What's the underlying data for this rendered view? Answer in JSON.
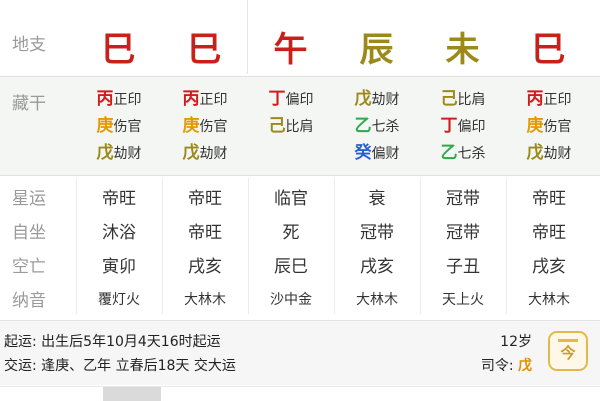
{
  "tiangan_top": [
    {
      "char": "",
      "color": "#2ea84a"
    },
    {
      "char": "",
      "color": "#2ea84a"
    },
    {
      "char": "",
      "color": "#2ea84a"
    },
    {
      "char": "",
      "color": "#2ea84a"
    },
    {
      "char": "",
      "color": "#2ea84a"
    },
    {
      "char": "",
      "color": "#2ea84a"
    }
  ],
  "dizhi": {
    "label": "地支",
    "columns": [
      {
        "char": "巳",
        "color": "#c8201a"
      },
      {
        "char": "巳",
        "color": "#c8201a"
      },
      {
        "char": "午",
        "color": "#c8201a"
      },
      {
        "char": "辰",
        "color": "#9b8a1a"
      },
      {
        "char": "未",
        "color": "#9b8a1a"
      },
      {
        "char": "巳",
        "color": "#c8201a"
      }
    ]
  },
  "canggan": {
    "label": "藏干",
    "columns": [
      [
        {
          "gan": "丙",
          "shishen": "正印",
          "color": "#d21c1c"
        },
        {
          "gan": "庚",
          "shishen": "伤官",
          "color": "#e39a00"
        },
        {
          "gan": "戊",
          "shishen": "劫财",
          "color": "#9b8a1a"
        }
      ],
      [
        {
          "gan": "丙",
          "shishen": "正印",
          "color": "#d21c1c"
        },
        {
          "gan": "庚",
          "shishen": "伤官",
          "color": "#e39a00"
        },
        {
          "gan": "戊",
          "shishen": "劫财",
          "color": "#9b8a1a"
        }
      ],
      [
        {
          "gan": "丁",
          "shishen": "偏印",
          "color": "#d21c1c"
        },
        {
          "gan": "己",
          "shishen": "比肩",
          "color": "#9b8a1a"
        }
      ],
      [
        {
          "gan": "戊",
          "shishen": "劫财",
          "color": "#9b8a1a"
        },
        {
          "gan": "乙",
          "shishen": "七杀",
          "color": "#2ea84a"
        },
        {
          "gan": "癸",
          "shishen": "偏财",
          "color": "#2a5fd4"
        }
      ],
      [
        {
          "gan": "己",
          "shishen": "比肩",
          "color": "#9b8a1a"
        },
        {
          "gan": "丁",
          "shishen": "偏印",
          "color": "#d21c1c"
        },
        {
          "gan": "乙",
          "shishen": "七杀",
          "color": "#2ea84a"
        }
      ],
      [
        {
          "gan": "丙",
          "shishen": "正印",
          "color": "#d21c1c"
        },
        {
          "gan": "庚",
          "shishen": "伤官",
          "color": "#e39a00"
        },
        {
          "gan": "戊",
          "shishen": "劫财",
          "color": "#9b8a1a"
        }
      ]
    ]
  },
  "rows": {
    "xingyun": {
      "label": "星运",
      "values": [
        "帝旺",
        "帝旺",
        "临官",
        "衰",
        "冠带",
        "帝旺"
      ]
    },
    "zizuo": {
      "label": "自坐",
      "values": [
        "沐浴",
        "帝旺",
        "死",
        "冠带",
        "冠带",
        "帝旺"
      ]
    },
    "kongwang": {
      "label": "空亡",
      "values": [
        "寅卯",
        "戌亥",
        "辰巳",
        "戌亥",
        "子丑",
        "戌亥"
      ]
    },
    "nayin": {
      "label": "纳音",
      "values": [
        "覆灯火",
        "大林木",
        "沙中金",
        "大林木",
        "天上火",
        "大林木"
      ]
    }
  },
  "bottom": {
    "qiyun": "起运:  出生后5年10月4天16时起运",
    "jiaoyun": "交运:  逢庚、乙年 立春后18天 交大运",
    "age": "12岁",
    "siling_label": "司令:",
    "siling_value": "戊",
    "calendar_char": "今"
  }
}
